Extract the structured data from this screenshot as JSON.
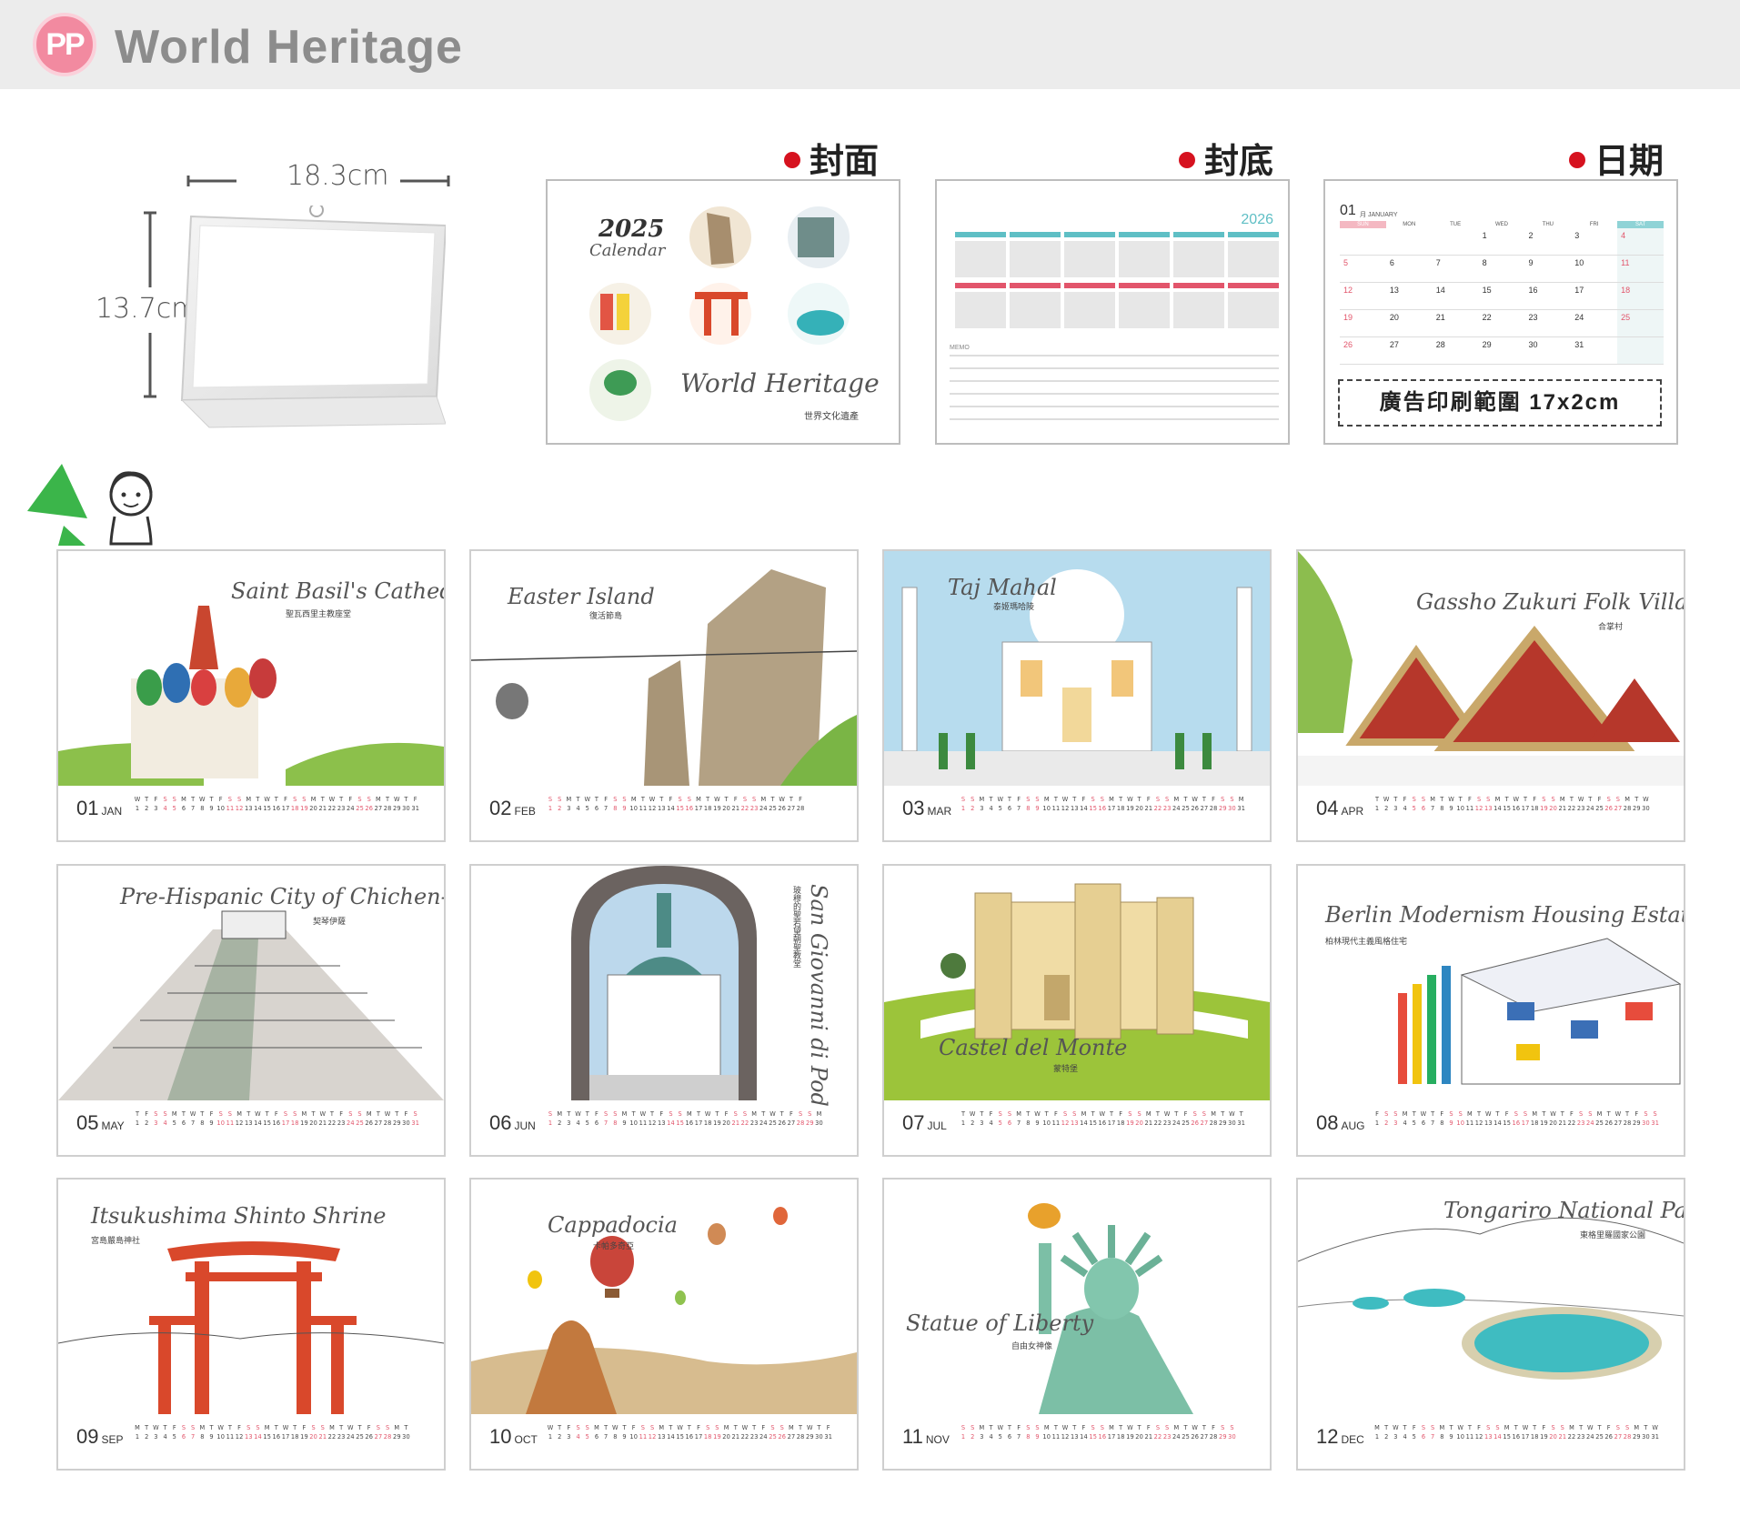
{
  "header": {
    "logo_text": "PP",
    "brand": "World Heritage"
  },
  "size": {
    "width": "18.3cm",
    "height": "13.7cm"
  },
  "previews": {
    "cover": {
      "title": "封面",
      "year": "2025",
      "calendar_word": "Calendar",
      "script": "World Heritage",
      "cn": "世界文化遺產"
    },
    "back": {
      "title": "封底",
      "year": "2026",
      "memo": "MEMO"
    },
    "date": {
      "title": "日期",
      "month_num": "01",
      "month_label": "月 JANUARY",
      "weekdays": [
        "SUN",
        "MON",
        "TUE",
        "WED",
        "THU",
        "FRI",
        "SAT"
      ],
      "weeks": [
        [
          "",
          "",
          "",
          "1",
          "2",
          "3",
          "4"
        ],
        [
          "5",
          "6",
          "7",
          "8",
          "9",
          "10",
          "11"
        ],
        [
          "12",
          "13",
          "14",
          "15",
          "16",
          "17",
          "18"
        ],
        [
          "19",
          "20",
          "21",
          "22",
          "23",
          "24",
          "25"
        ],
        [
          "26",
          "27",
          "28",
          "29",
          "30",
          "31",
          ""
        ]
      ],
      "ad": "廣告印刷範圍 17x2cm"
    }
  },
  "months": [
    {
      "num": "01",
      "abbr": "JAN",
      "script": "Saint Basil's Cathedral",
      "cn": "聖瓦西里主教座堂",
      "days": 31
    },
    {
      "num": "02",
      "abbr": "FEB",
      "script": "Easter Island",
      "cn": "復活節島",
      "days": 28
    },
    {
      "num": "03",
      "abbr": "MAR",
      "script": "Taj Mahal",
      "cn": "泰姬瑪哈陵",
      "days": 31
    },
    {
      "num": "04",
      "abbr": "APR",
      "script": "Gassho Zukuri Folk Village",
      "cn": "合掌村",
      "days": 30
    },
    {
      "num": "05",
      "abbr": "MAY",
      "script": "Pre-Hispanic City of Chichen-Itza",
      "cn": "契琴伊薩",
      "days": 31
    },
    {
      "num": "06",
      "abbr": "JUN",
      "script": "San Giovanni di Pod",
      "cn": "玻穆的聖若望朝聖教堂",
      "days": 30
    },
    {
      "num": "07",
      "abbr": "JUL",
      "script": "Castel del Monte",
      "cn": "蒙特堡",
      "days": 31
    },
    {
      "num": "08",
      "abbr": "AUG",
      "script": "Berlin Modernism Housing Estates",
      "cn": "柏林現代主義風格住宅",
      "days": 31
    },
    {
      "num": "09",
      "abbr": "SEP",
      "script": "Itsukushima Shinto Shrine",
      "cn": "宮島嚴島神社",
      "days": 30
    },
    {
      "num": "10",
      "abbr": "OCT",
      "script": "Cappadocia",
      "cn": "卡帕多奇亞",
      "days": 31
    },
    {
      "num": "11",
      "abbr": "NOV",
      "script": "Statue of Liberty",
      "cn": "自由女神像",
      "days": 30
    },
    {
      "num": "12",
      "abbr": "DEC",
      "script": "Tongariro National Park",
      "cn": "東格里羅國家公園",
      "days": 31
    }
  ],
  "colors": {
    "accent_red": "#d6121f",
    "weekend_pink": "#e2556b",
    "teal": "#5fbfc5",
    "brand_pink": "#f28aa0"
  }
}
